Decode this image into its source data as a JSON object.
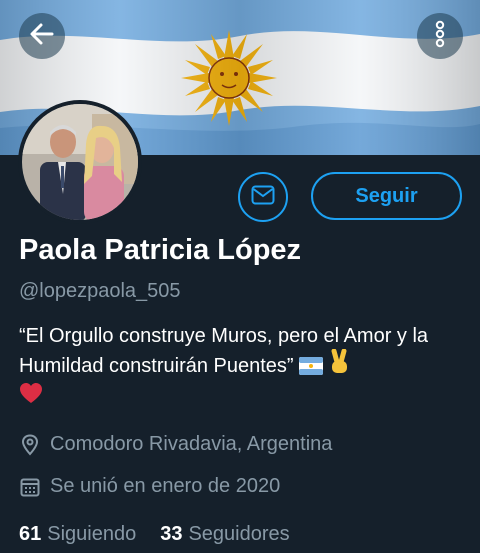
{
  "profile": {
    "name": "Paola Patricia López",
    "handle": "@lopezpaola_505",
    "bio_text": "“El Orgullo construye Muros, pero el Amor y la Humildad construirán Puentes”",
    "location": "Comodoro Rivadavia, Argentina",
    "joined": "Se unió en enero de 2020"
  },
  "actions": {
    "follow_label": "Seguir"
  },
  "stats": {
    "following_count": "61",
    "following_label": "Siguiendo",
    "followers_count": "33",
    "followers_label": "Seguidores"
  },
  "icons": {
    "back": "arrow-left-icon",
    "more": "more-vertical-icon",
    "message": "envelope-icon",
    "location": "location-pin-icon",
    "calendar": "calendar-icon",
    "bio_emojis": [
      "argentina-flag",
      "victory-hand",
      "red-heart"
    ]
  },
  "colors": {
    "background": "#15202b",
    "accent": "#1da1f2",
    "secondary_text": "#8899a6",
    "flag_blue": "#74acdf",
    "sun": "#f6b40e"
  }
}
